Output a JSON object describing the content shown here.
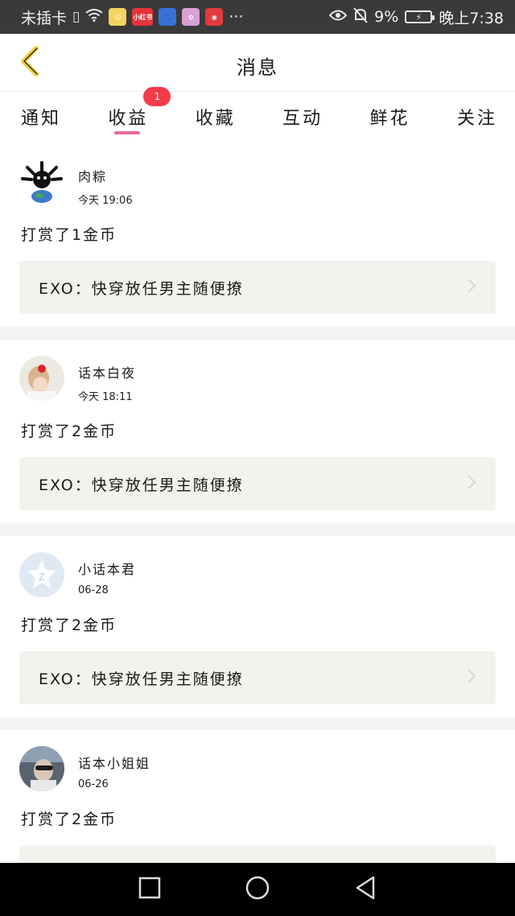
{
  "status_bar": {
    "carrier": "未插卡",
    "apps": [
      {
        "name": "app-icon-face",
        "color": "#f4d35e",
        "label": ""
      },
      {
        "name": "app-icon-xiaohongshu",
        "color": "#e8333b",
        "label": "小红书"
      },
      {
        "name": "app-icon-baidu",
        "color": "#3b6fd8",
        "label": ""
      },
      {
        "name": "app-icon-flower",
        "color": "#d9a0d6",
        "label": ""
      },
      {
        "name": "app-icon-music",
        "color": "#e23a3a",
        "label": ""
      }
    ],
    "more": "···",
    "battery": "9%",
    "time": "晚上7:38"
  },
  "header": {
    "title": "消息"
  },
  "tabs": [
    {
      "label": "通知"
    },
    {
      "label": "收益",
      "active": true,
      "badge": "1"
    },
    {
      "label": "收藏"
    },
    {
      "label": "互动"
    },
    {
      "label": "鲜花"
    },
    {
      "label": "关注"
    }
  ],
  "messages": [
    {
      "user": "肉粽",
      "time": "今天 19:06",
      "reward": "打赏了1金币",
      "book": "EXO：快穿放任男主随便撩",
      "avatar": "avatar-spiky"
    },
    {
      "user": "话本白夜",
      "time": "今天 18:11",
      "reward": "打赏了2金币",
      "book": "EXO：快穿放任男主随便撩",
      "avatar": "avatar-girl"
    },
    {
      "user": "小话本君",
      "time": "06-28",
      "reward": "打赏了2金币",
      "book": "EXO：快穿放任男主随便撩",
      "avatar": "avatar-default"
    },
    {
      "user": "话本小姐姐",
      "time": "06-26",
      "reward": "打赏了2金币",
      "book": "",
      "avatar": "avatar-man"
    }
  ],
  "colors": {
    "accent": "#e86b92",
    "badge": "#f23c4a",
    "back_arrow": "#f2d23c",
    "book_bg": "#f3f3ee"
  }
}
